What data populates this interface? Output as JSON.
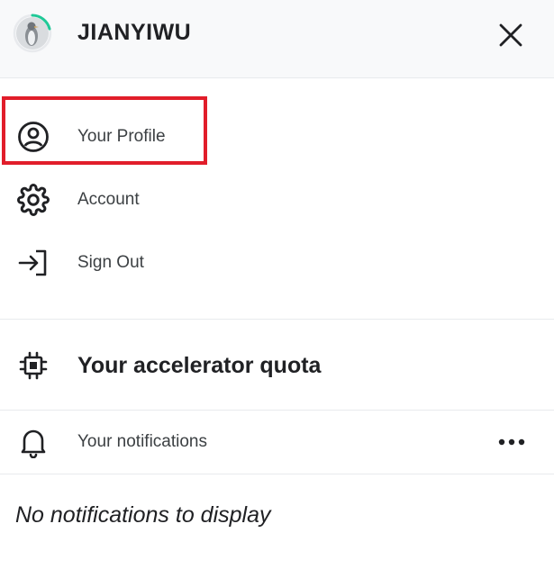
{
  "header": {
    "username": "JIANYIWU",
    "avatar_icon": "penguin-avatar-icon",
    "progress_color": "#20c997",
    "close_icon": "close-icon"
  },
  "menu": {
    "items": [
      {
        "label": "Your Profile",
        "icon": "profile-circle-icon"
      },
      {
        "label": "Account",
        "icon": "gear-icon"
      },
      {
        "label": "Sign Out",
        "icon": "sign-out-icon"
      }
    ],
    "highlight_color": "#e11d2a"
  },
  "quota": {
    "label": "Your accelerator quota",
    "icon": "chip-icon"
  },
  "notifications": {
    "label": "Your notifications",
    "icon": "bell-icon",
    "more_icon": "more-horizontal-icon",
    "empty_text": "No notifications to display"
  }
}
